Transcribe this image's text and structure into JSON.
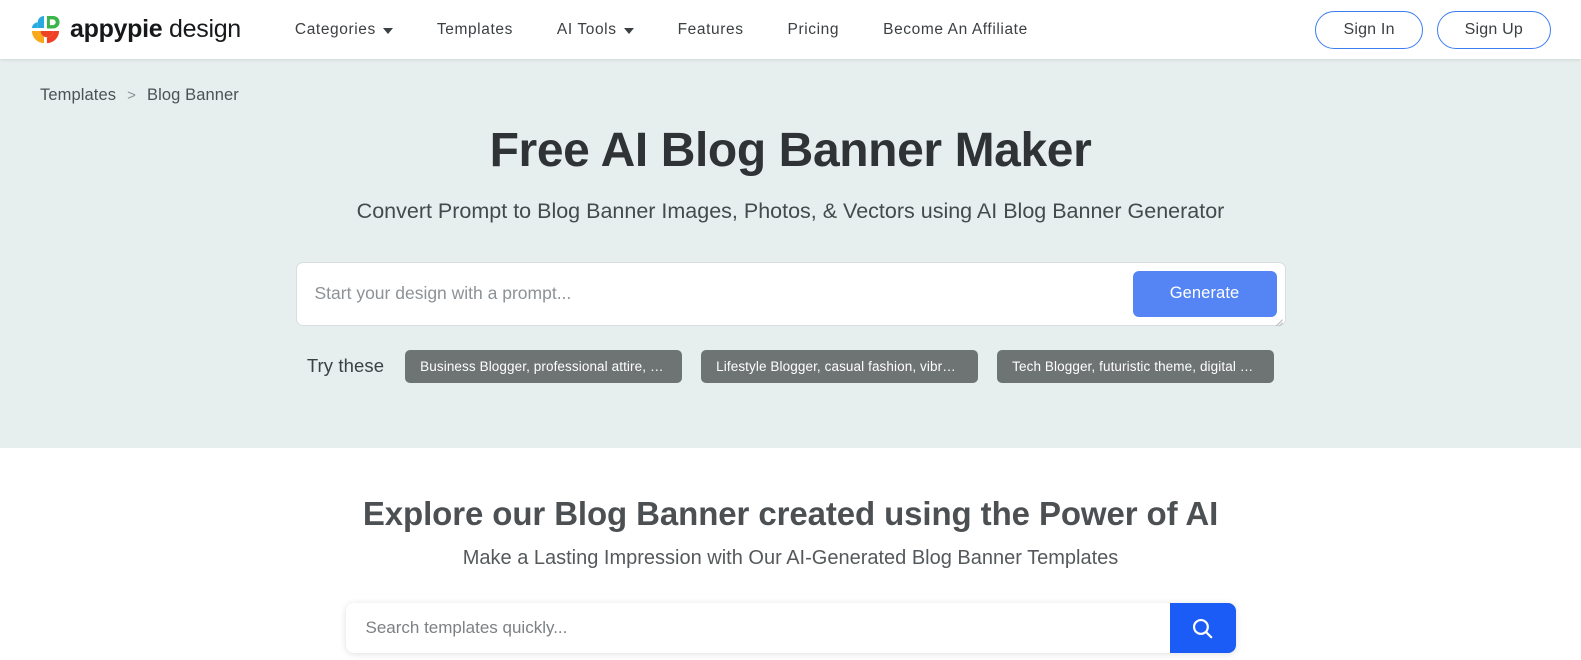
{
  "header": {
    "brand": {
      "icon": "appypie-logo-icon",
      "name_strong": "appypie",
      "name_light": "design",
      "logo_colors": {
        "top_left": "#29a9e1",
        "top_right": "#3bb54a",
        "bottom_left": "#f7a81b",
        "bottom_right": "#ef4123"
      }
    },
    "nav": [
      {
        "label": "Categories",
        "has_dropdown": true
      },
      {
        "label": "Templates",
        "has_dropdown": false
      },
      {
        "label": "AI Tools",
        "has_dropdown": true
      },
      {
        "label": "Features",
        "has_dropdown": false
      },
      {
        "label": "Pricing",
        "has_dropdown": false
      },
      {
        "label": "Become An Affiliate",
        "has_dropdown": false
      }
    ],
    "auth": {
      "sign_in_label": "Sign In",
      "sign_up_label": "Sign Up",
      "border_color": "#3b7ef2"
    }
  },
  "breadcrumb": {
    "parent": "Templates",
    "separator": ">",
    "current": "Blog Banner"
  },
  "hero": {
    "background_color": "#e7efee",
    "title": "Free AI Blog Banner Maker",
    "subtitle": "Convert Prompt to Blog Banner Images, Photos, & Vectors using AI Blog Banner Generator",
    "prompt": {
      "value": "",
      "placeholder": "Start your design with a prompt...",
      "generate_label": "Generate",
      "generate_color": "#5585f5",
      "resize_handle": "resize-grip-icon"
    },
    "try_these": {
      "label": "Try these",
      "chip_color": "#6e7374",
      "chips": [
        "Business Blogger, professional attire, mini...",
        "Lifestyle Blogger, casual fashion, vibrant a...",
        "Tech Blogger, futuristic theme, digital elem..."
      ]
    }
  },
  "explore": {
    "title": "Explore our Blog Banner created using the Power of AI",
    "subtitle": "Make a Lasting Impression with Our AI-Generated Blog Banner Templates",
    "search": {
      "value": "",
      "placeholder": "Search templates quickly...",
      "button_icon": "search-icon",
      "button_color": "#1a5cf5"
    }
  }
}
